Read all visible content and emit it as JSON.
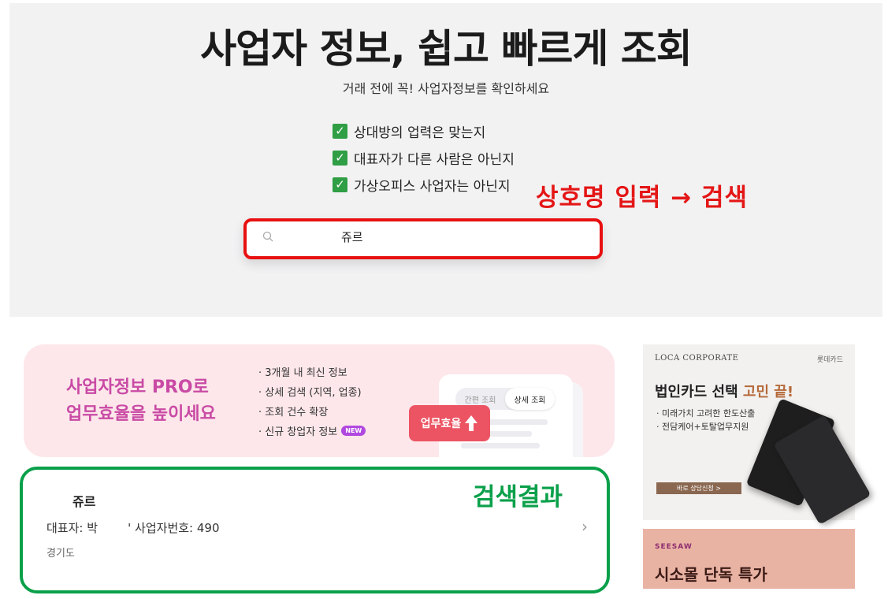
{
  "hero": {
    "title": "사업자 정보, 쉽고 빠르게 조회",
    "subtitle": "거래 전에 꼭! 사업자정보를 확인하세요",
    "checklist": [
      "상대방의 업력은 맞는지",
      "대표자가 다른 사람은 아닌지",
      "가상오피스 사업자는 아닌지"
    ],
    "check_mark": "✓"
  },
  "annotations": {
    "search_hint": "상호명 입력 → 검색",
    "result_hint": "검색결과"
  },
  "search": {
    "value": "쥬르",
    "icon": "search-icon"
  },
  "promo": {
    "title_line1": "사업자정보 PRO로",
    "title_line2": "업무효율을 높이세요",
    "items": [
      "· 3개월 내 최신 정보",
      "· 상세 검색 (지역, 업종)",
      "· 조회 건수 확장",
      "· 신규 창업자 정보"
    ],
    "new_badge": "NEW",
    "tab_simple": "간편 조회",
    "tab_detail": "상세 조회",
    "efficiency_label": "업무효율"
  },
  "result": {
    "name": "쥬르",
    "detail": "대표자: 박        ' 사업자번호: 490",
    "region": "경기도",
    "chevron": "›"
  },
  "ad_card": {
    "brand": "LOCA CORPORATE",
    "brand_right": "롯데카드",
    "title_prefix": "법인카드 선택 ",
    "title_highlight": "고민 끝!",
    "line1": "· 미래가치 고려한 한도산출",
    "line2": "· 전담케어+토탈업무지원",
    "button": "바로 상담신청 >"
  },
  "ad_seesaw": {
    "brand": "SEESAW",
    "title": "시소몰 단독 특가"
  },
  "colors": {
    "annotation_red": "#e41616",
    "annotation_green": "#0aa04a",
    "promo_pink": "#c94aa5"
  }
}
